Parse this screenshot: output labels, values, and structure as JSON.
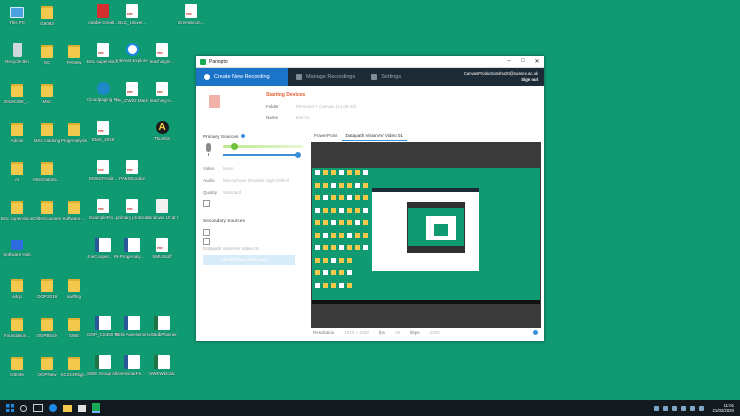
{
  "desktop_icons": [
    {
      "label": "This PC",
      "type": "pc",
      "col": 0,
      "row": 0
    },
    {
      "label": "Recycle Bin",
      "type": "recycle",
      "col": 0,
      "row": 1
    },
    {
      "label": "2019CWK_...",
      "type": "folder",
      "col": 0,
      "row": 2
    },
    {
      "label": "Admin",
      "type": "folder",
      "col": 0,
      "row": 3
    },
    {
      "label": "AI",
      "type": "folder",
      "col": 0,
      "row": 4
    },
    {
      "label": "BSc supervision",
      "type": "folder",
      "col": 0,
      "row": 5
    },
    {
      "label": "Software Hub",
      "type": "netw",
      "col": 0,
      "row": 6
    },
    {
      "label": "edcp",
      "type": "folder",
      "col": 0,
      "row": 7
    },
    {
      "label": "Foundation...",
      "type": "folder",
      "col": 0,
      "row": 8
    },
    {
      "label": "G6046",
      "type": "folder",
      "col": 0,
      "row": 9
    },
    {
      "label": "G6083",
      "type": "folder",
      "col": 1,
      "row": 0
    },
    {
      "label": "GC",
      "type": "folder",
      "col": 1,
      "row": 1
    },
    {
      "label": "MSc",
      "type": "folder",
      "col": 1,
      "row": 2
    },
    {
      "label": "MSc marking",
      "type": "folder",
      "col": 1,
      "row": 3
    },
    {
      "label": "MScDataSc...",
      "type": "folder",
      "col": 1,
      "row": 4
    },
    {
      "label": "OlderCourses",
      "type": "folder",
      "col": 1,
      "row": 5
    },
    {
      "label": "OOP2019",
      "type": "folder",
      "col": 1,
      "row": 7
    },
    {
      "label": "OOPBlock",
      "type": "folder",
      "col": 1,
      "row": 8
    },
    {
      "label": "OOPNew",
      "type": "folder",
      "col": 1,
      "row": 9
    },
    {
      "label": "PANew",
      "type": "folder",
      "col": 2,
      "row": 1
    },
    {
      "label": "ProgAnalysis",
      "type": "folder",
      "col": 2,
      "row": 3
    },
    {
      "label": "Software-...",
      "type": "folder",
      "col": 2,
      "row": 5
    },
    {
      "label": "swiftng",
      "type": "folder",
      "col": 2,
      "row": 7
    },
    {
      "label": "SWE",
      "type": "folder",
      "col": 2,
      "row": 8
    },
    {
      "label": "SCSCRIbgr...",
      "type": "folder",
      "col": 2,
      "row": 9
    },
    {
      "label": "Adobe Creati...",
      "type": "acrobat",
      "col": 3,
      "row": 0
    },
    {
      "label": "BSc supervisio...",
      "type": "pdf",
      "col": 3,
      "row": 1
    },
    {
      "label": "Cloudpaging Player",
      "type": "app",
      "col": 3,
      "row": 2
    },
    {
      "label": "EMS_2019",
      "type": "pdf",
      "col": 3,
      "row": 3
    },
    {
      "label": "EMSCPostit...",
      "type": "pdf",
      "col": 3,
      "row": 4
    },
    {
      "label": "ExampleFin...",
      "type": "pdf",
      "col": 3,
      "row": 5
    },
    {
      "label": "JoeCooper... Report",
      "type": "word",
      "col": 3,
      "row": 6
    },
    {
      "label": "OOP_CS450 Major chan...",
      "type": "word",
      "col": 3,
      "row": 8
    },
    {
      "label": "SWE Group Allocations",
      "type": "excel",
      "col": 3,
      "row": 9
    },
    {
      "label": "GLC_Univer...",
      "type": "pdf",
      "col": 4,
      "row": 0
    },
    {
      "label": "Internet Explorer",
      "type": "ie",
      "col": 4,
      "row": 1
    },
    {
      "label": "PA_CW02 Markin...",
      "type": "pdf",
      "col": 4,
      "row": 2
    },
    {
      "label": "PAEMCode2",
      "type": "pdf",
      "col": 4,
      "row": 4
    },
    {
      "label": "primary protocol...",
      "type": "pdf",
      "col": 4,
      "row": 5
    },
    {
      "label": "ProgAnaly...",
      "type": "word",
      "col": 4,
      "row": 6
    },
    {
      "label": "Risk Assessme...",
      "type": "word",
      "col": 4,
      "row": 8
    },
    {
      "label": "SeminarFe...",
      "type": "word",
      "col": 4,
      "row": 9
    },
    {
      "label": "GreenEcon...",
      "type": "pdf",
      "col": 6,
      "row": 0
    },
    {
      "label": "teachingm...",
      "type": "pdf",
      "col": 5,
      "row": 1
    },
    {
      "label": "teaching-s...",
      "type": "pdf",
      "col": 5,
      "row": 2
    },
    {
      "label": "Thumbs",
      "type": "yellowA",
      "col": 5,
      "row": 3
    },
    {
      "label": "Windows 10 at Sussex",
      "type": "doc",
      "col": 5,
      "row": 5
    },
    {
      "label": "SMUStuff",
      "type": "pdf",
      "col": 5,
      "row": 6
    },
    {
      "label": "USBdbPlanner",
      "type": "excel",
      "col": 5,
      "row": 8
    },
    {
      "label": "SWEWkCalc",
      "type": "excel",
      "col": 5,
      "row": 9
    }
  ],
  "window": {
    "title": "Panopto",
    "controls": {
      "minimize": "–",
      "maximize": "□",
      "close": "✕"
    },
    "nav": {
      "create": "Create New Recording",
      "manage": "Manage Recordings",
      "settings": "Settings"
    },
    "account": {
      "email": "CanvasProductionshu20@sussex.ac.uk",
      "signout": "Sign out"
    },
    "status": "Starting Devices",
    "folder_label": "Folder",
    "folder_value": "Personal Y Canvas (14.09.20)",
    "name_label": "Name",
    "name_value": "test 01",
    "primary_sources": "Primary Sources",
    "video_label": "Video",
    "video_value": "None",
    "audio_label": "Audio",
    "audio_value": "Microphone (Realtek High Definit",
    "quality_label": "Quality",
    "quality_value": "Standard",
    "secondary_sources": "Secondary Sources",
    "capture_source": "Datapath VisionAV Video 01",
    "add_button": "Add another video source",
    "tabs": [
      "PowerPoint",
      "Datapath VisionAV Video 01"
    ],
    "res_label": "Resolution",
    "res_value": "1920 x 1080",
    "fps_label": "fps",
    "fps_value": "30",
    "kbps_label": "kbps",
    "kbps_value": "2000"
  },
  "taskbar": {
    "time": "11:01",
    "date": "21/02/2020"
  }
}
